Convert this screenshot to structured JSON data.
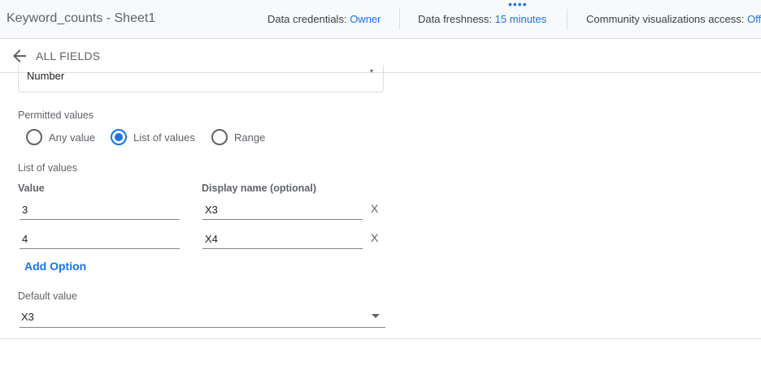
{
  "topbar": {
    "title": "Keyword_counts - Sheet1",
    "credentials_label": "Data credentials:",
    "credentials_value": "Owner",
    "freshness_label": "Data freshness:",
    "freshness_value": "15 minutes",
    "community_label": "Community visualizations access:",
    "community_value": "Off"
  },
  "fieldsbar": {
    "back_icon": "arrow-left-icon",
    "label": "ALL FIELDS"
  },
  "type_select": {
    "value": "Number"
  },
  "permitted_values": {
    "label": "Permitted values",
    "options": [
      {
        "label": "Any value",
        "checked": false
      },
      {
        "label": "List of values",
        "checked": true
      },
      {
        "label": "Range",
        "checked": false
      }
    ]
  },
  "list_of_values": {
    "label": "List of values",
    "value_header": "Value",
    "display_header": "Display name (optional)",
    "rows": [
      {
        "value": "3",
        "display": "X3",
        "remove": "X"
      },
      {
        "value": "4",
        "display": "X4",
        "remove": "X"
      }
    ],
    "add_option": "Add Option"
  },
  "default_value": {
    "label": "Default value",
    "value": "X3"
  },
  "colors": {
    "accent": "#1a73e8",
    "text_secondary": "#5f6368",
    "divider": "#dadce0"
  }
}
